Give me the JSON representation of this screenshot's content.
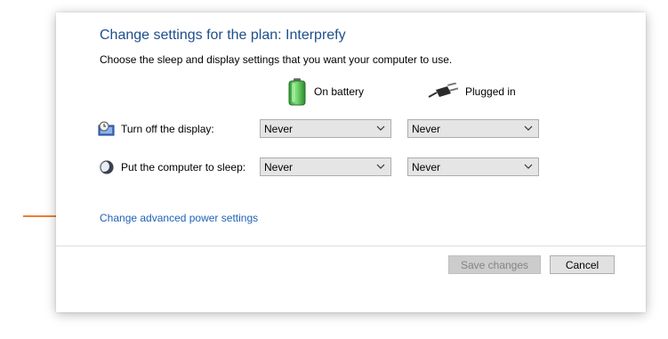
{
  "window": {
    "title": "Change settings for the plan: Interprefy",
    "subtitle": "Choose the sleep and display settings that you want your computer to use."
  },
  "columns": {
    "battery": {
      "label": "On battery",
      "icon": "battery-icon"
    },
    "plugged": {
      "label": "Plugged in",
      "icon": "power-plug-icon"
    }
  },
  "rows": [
    {
      "label": "Turn off the display:",
      "icon": "display-timer-icon",
      "battery_value": "Never",
      "plugged_value": "Never"
    },
    {
      "label": "Put the computer to sleep:",
      "icon": "sleep-moon-icon",
      "battery_value": "Never",
      "plugged_value": "Never"
    }
  ],
  "advanced_link": "Change advanced power settings",
  "buttons": {
    "save": "Save changes",
    "cancel": "Cancel"
  },
  "colors": {
    "title": "#1e4e8c",
    "link": "#1e62b8",
    "annotation_arrow": "#ef7d31"
  }
}
